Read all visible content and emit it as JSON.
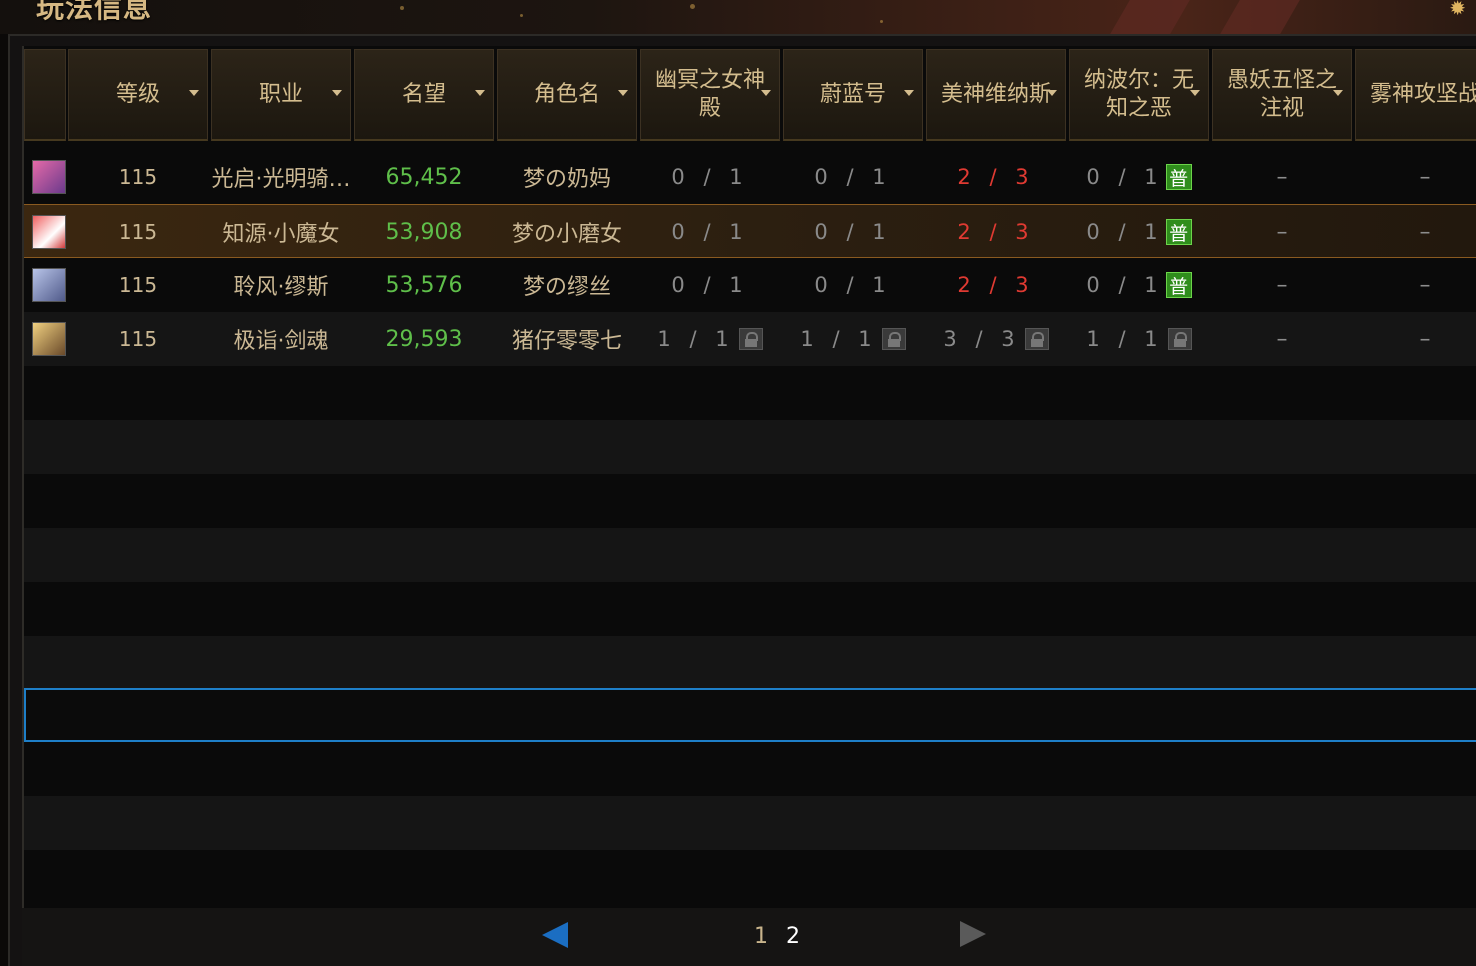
{
  "banner": {
    "title": "玩法信息"
  },
  "header": {
    "columns": [
      {
        "label": ""
      },
      {
        "label": "等级"
      },
      {
        "label": "职业"
      },
      {
        "label": "名望"
      },
      {
        "label": "角色名"
      },
      {
        "label": "幽冥之女神殿"
      },
      {
        "label": "蔚蓝号"
      },
      {
        "label": "美神维纳斯"
      },
      {
        "label": "纳波尔：无知之恶"
      },
      {
        "label": "愚妖五怪之注视"
      },
      {
        "label": "雾神攻坚战"
      }
    ]
  },
  "rows": [
    {
      "avatar_color": "#c44a8a",
      "level": "115",
      "job": "光启·光明骑…",
      "fame": "65,452",
      "name": "梦の奶妈",
      "c1": "0 / 1",
      "c2": "0 / 1",
      "c3": "2 / 3",
      "c4": "0 / 1",
      "c4_tag": "普",
      "c5": "–",
      "c6": "–"
    },
    {
      "avatar_color": "#d23a3a",
      "level": "115",
      "job": "知源·小魔女",
      "fame": "53,908",
      "name": "梦の小磨女",
      "c1": "0 / 1",
      "c2": "0 / 1",
      "c3": "2 / 3",
      "c4": "0 / 1",
      "c4_tag": "普",
      "c5": "–",
      "c6": "–"
    },
    {
      "avatar_color": "#7a86b8",
      "level": "115",
      "job": "聆风·缪斯",
      "fame": "53,576",
      "name": "梦の缪丝",
      "c1": "0 / 1",
      "c2": "0 / 1",
      "c3": "2 / 3",
      "c4": "0 / 1",
      "c4_tag": "普",
      "c5": "–",
      "c6": "–"
    },
    {
      "avatar_color": "#c89a44",
      "level": "115",
      "job": "极诣·剑魂",
      "fame": "29,593",
      "name": "猪仔零零七",
      "c1": "1 / 1",
      "c2": "1 / 1",
      "c3": "3 / 3",
      "c4": "1 / 1",
      "c5": "–",
      "c6": "–"
    }
  ],
  "pagination": {
    "pages": [
      "1",
      "2"
    ],
    "current": "2"
  },
  "colors": {
    "accent_blue": "#1e7fc8",
    "fame_green": "#5fbf4a",
    "progress_red": "#e03a32",
    "tag_green": "#2f8d1c"
  }
}
